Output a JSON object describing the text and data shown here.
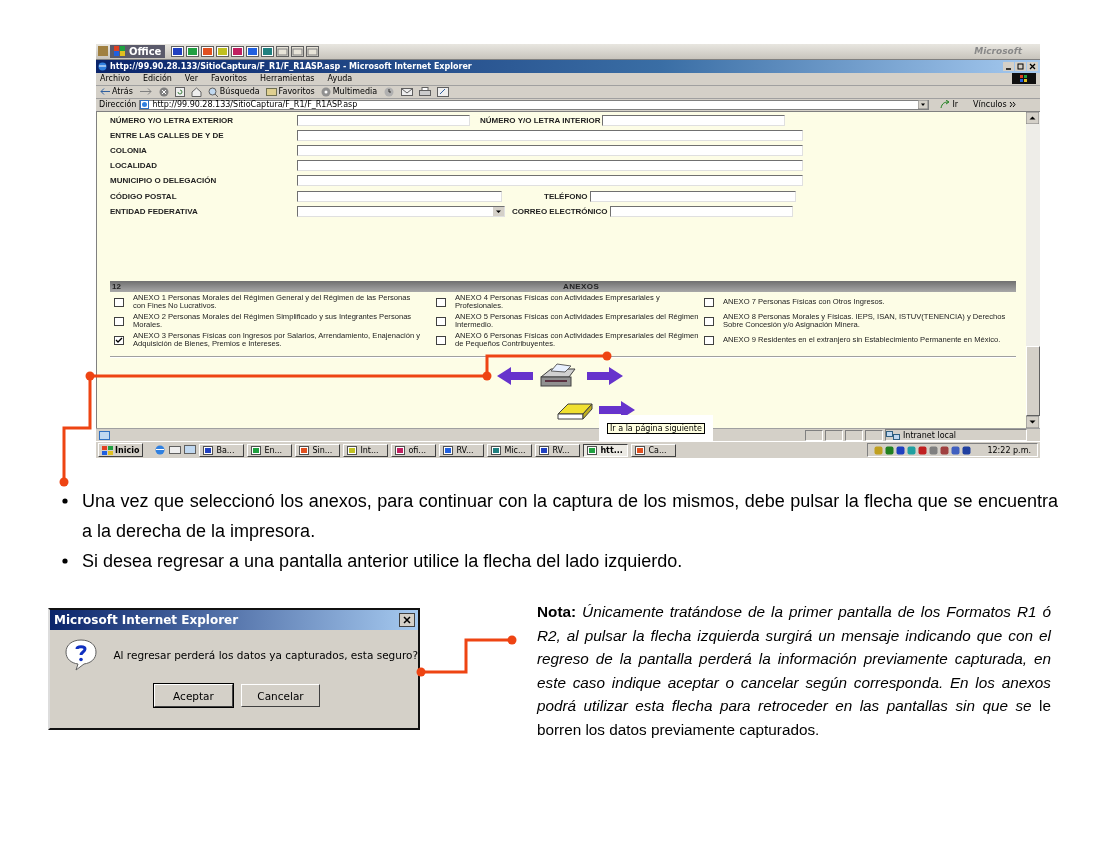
{
  "browser": {
    "office_bar": {
      "title": "Office",
      "brand": "Microsoft"
    },
    "title": "http://99.90.28.133/SitioCaptura/F_R1/F_R1ASP.asp - Microsoft Internet Explorer",
    "menu": [
      "Archivo",
      "Edición",
      "Ver",
      "Favoritos",
      "Herramientas",
      "Ayuda"
    ],
    "toolbar": {
      "back": "Atrás",
      "search": "Búsqueda",
      "favorites": "Favoritos",
      "media": "Multimedia"
    },
    "address": {
      "label": "Dirección",
      "value": "http://99.90.28.133/SitioCaptura/F_R1/F_R1ASP.asp",
      "go": "Ir",
      "links": "Vínculos"
    },
    "form": [
      {
        "label": "NÚMERO Y/O LETRA EXTERIOR",
        "kind": "short",
        "second_label": "NÚMERO Y/O LETRA INTERIOR"
      },
      {
        "label": "ENTRE LAS CALLES DE Y DE",
        "kind": "long"
      },
      {
        "label": "COLONIA",
        "kind": "long"
      },
      {
        "label": "LOCALIDAD",
        "kind": "long"
      },
      {
        "label": "MUNICIPIO O DELEGACIÓN",
        "kind": "long"
      },
      {
        "label": "CÓDIGO POSTAL",
        "kind": "short",
        "second_label": "TELÉFONO"
      },
      {
        "label": "ENTIDAD FEDERATIVA",
        "kind": "select",
        "second_label": "CORREO ELECTRÓNICO"
      }
    ],
    "annexes": {
      "number": "12",
      "title": "ANEXOS",
      "columns": [
        [
          {
            "text": "ANEXO 1 Personas Morales del Régimen General y del Régimen de las Personas con Fines No Lucrativos.",
            "checked": false
          },
          {
            "text": "ANEXO 2 Personas Morales del Régimen Simplificado y sus Integrantes Personas Morales.",
            "checked": false
          },
          {
            "text": "ANEXO 3 Personas Físicas con Ingresos por Salarios, Arrendamiento, Enajenación y Adquisición de Bienes, Premios e Intereses.",
            "checked": true
          }
        ],
        [
          {
            "text": "ANEXO 4 Personas Físicas con Actividades Empresariales y Profesionales.",
            "checked": false
          },
          {
            "text": "ANEXO 5 Personas Físicas con Actividades Empresariales del Régimen Intermedio.",
            "checked": false
          },
          {
            "text": "ANEXO 6 Personas Físicas con Actividades Empresariales del Régimen de Pequeños Contribuyentes.",
            "checked": false
          }
        ],
        [
          {
            "text": "ANEXO 7 Personas Físicas con Otros Ingresos.",
            "checked": false
          },
          {
            "text": "ANEXO 8 Personas Morales y Físicas. IEPS, ISAN, ISTUV(TENENCIA) y Derechos Sobre Concesión y/o Asignación Minera.",
            "checked": false
          },
          {
            "text": "ANEXO 9 Residentes en el extranjero sin Establecimiento Permanente en México.",
            "checked": false
          }
        ]
      ]
    },
    "tooltip": "Ir a la página siguiente",
    "status": {
      "zone": "Intranet local"
    },
    "taskbar": {
      "start": "Inicio",
      "tasks": [
        {
          "label": "Ba...",
          "selected": false
        },
        {
          "label": "En...",
          "selected": false
        },
        {
          "label": "Sin...",
          "selected": false
        },
        {
          "label": "Int...",
          "selected": false
        },
        {
          "label": "ofi...",
          "selected": false
        },
        {
          "label": "RV...",
          "selected": false
        },
        {
          "label": "Mic...",
          "selected": false
        },
        {
          "label": "RV...",
          "selected": false
        },
        {
          "label": "htt...",
          "selected": true
        },
        {
          "label": "Ca...",
          "selected": false
        }
      ],
      "clock": "12:22 p.m."
    }
  },
  "bullets": [
    "Una vez que seleccionó los anexos, para continuar con la captura de los mismos, debe pulsar la flecha que se encuentra a la derecha de la impresora.",
    "Si desea regresar a una pantalla anterior utilice la flecha del lado izquierdo."
  ],
  "dialog": {
    "title": "Microsoft Internet Explorer",
    "message": "Al regresar perderá los datos ya capturados, esta seguro?",
    "buttons": [
      "Aceptar",
      "Cancelar"
    ]
  },
  "note": "**Nota:** *Únicamente tratándose de  la primer pantalla de los Formatos  R1 ó R2, al pulsar la flecha izquierda surgirá un mensaje indicando que con el regreso de la pantalla perderá la información previamente capturada, en este caso indique aceptar o cancelar según corresponda. En los anexos podrá utilizar esta flecha para retroceder en las pantallas sin que se* le borren los  datos previamente capturados."
}
